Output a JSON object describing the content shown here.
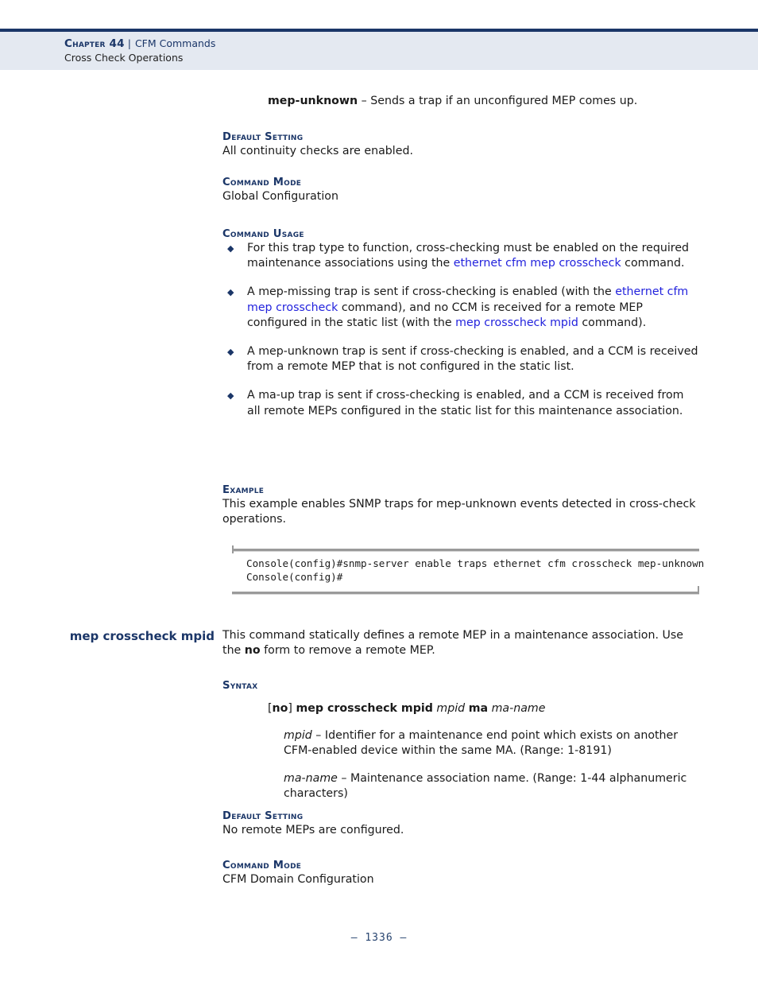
{
  "header": {
    "chapter": "Chapter 44",
    "separator": "|",
    "doc_title": "CFM Commands",
    "section": "Cross Check Operations"
  },
  "sections": {
    "trap_desc": {
      "term": "mep-unknown",
      "dash": "–",
      "text": "Sends a trap if an unconfigured MEP comes up."
    },
    "default_setting_1": {
      "heading": "Default Setting",
      "body": "All continuity checks are enabled."
    },
    "command_mode_1": {
      "heading": "Command Mode",
      "body": "Global Configuration"
    },
    "command_usage": {
      "heading": "Command Usage",
      "bullets": [
        {
          "part1": "For this trap type to function, cross-checking must be enabled on the required maintenance associations using the ",
          "link1": "ethernet cfm mep crosscheck",
          "part2": " command."
        },
        {
          "part1": "A mep-missing trap is sent if cross-checking is enabled (with the ",
          "link1": "ethernet cfm mep crosscheck",
          "part2": " command), and no CCM is received for a remote MEP configured in the static list (with the ",
          "link2": "mep crosscheck mpid",
          "part3": " command)."
        },
        {
          "part1": "A mep-unknown trap is sent if cross-checking is enabled, and a CCM is received from a remote MEP that is not configured in the static list."
        },
        {
          "part1": "A ma-up trap is sent if cross-checking is enabled, and a CCM is received from all remote MEPs configured in the static list for this maintenance association."
        }
      ]
    },
    "example": {
      "heading": "Example",
      "body": "This example enables SNMP traps for mep-unknown events detected in cross-check operations.",
      "console": "Console(config)#snmp-server enable traps ethernet cfm crosscheck mep-unknown\nConsole(config)#"
    },
    "command_entry": {
      "margin_title": "mep crosscheck mpid",
      "desc_part1": "This command statically defines a remote MEP in a maintenance association. Use the ",
      "desc_bold": "no",
      "desc_part2": " form to remove a remote MEP."
    },
    "syntax": {
      "heading": "Syntax",
      "line": {
        "open_bracket": "[",
        "no_keyword": "no",
        "close_bracket": "]",
        "command": "mep crosscheck mpid",
        "param1": "mpid",
        "keyword2": "ma",
        "param2": "ma-name"
      },
      "params": [
        {
          "name": "mpid",
          "dash": "–",
          "desc": "Identifier for a maintenance end point which exists on another CFM-enabled device within the same MA. (Range: 1-8191)"
        },
        {
          "name": "ma-name",
          "dash": "–",
          "desc": "Maintenance association name. (Range: 1-44 alphanumeric characters)"
        }
      ]
    },
    "default_setting_2": {
      "heading": "Default Setting",
      "body": "No remote MEPs are configured."
    },
    "command_mode_2": {
      "heading": "Command Mode",
      "body": "CFM Domain Configuration"
    }
  },
  "footer": {
    "page_number": "–  1336  –"
  },
  "colors": {
    "navy": "#1b3668",
    "link_blue": "#2222dd",
    "header_band": "#e4e9f1"
  }
}
